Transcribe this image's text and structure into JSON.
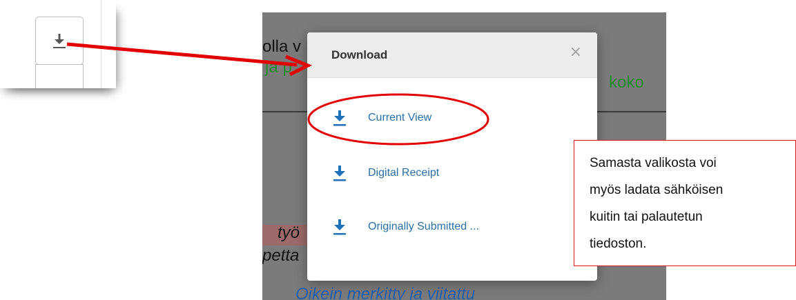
{
  "document": {
    "line1": "olla v",
    "line2a": "ja  p",
    "line2b": "koko",
    "line3": "työ",
    "line4": "petta",
    "line5": "Oikein merkitty ja viitattu"
  },
  "modal": {
    "title": "Download",
    "close_symbol": "×",
    "items": [
      {
        "label": "Current View",
        "icon": "download-icon"
      },
      {
        "label": "Digital Receipt",
        "icon": "download-icon"
      },
      {
        "label": "Originally Submitted ...",
        "icon": "download-icon"
      }
    ]
  },
  "callout": {
    "lines": [
      "Samasta    valikosta    voi",
      "myös ladata sähköisen",
      "kuitin    tai    palautetun",
      "tiedoston."
    ]
  },
  "colors": {
    "accent": "#2a6fa3",
    "annotation_red": "#e30000",
    "doc_green": "#1f8a2e",
    "doc_blue": "#1f5fae"
  }
}
